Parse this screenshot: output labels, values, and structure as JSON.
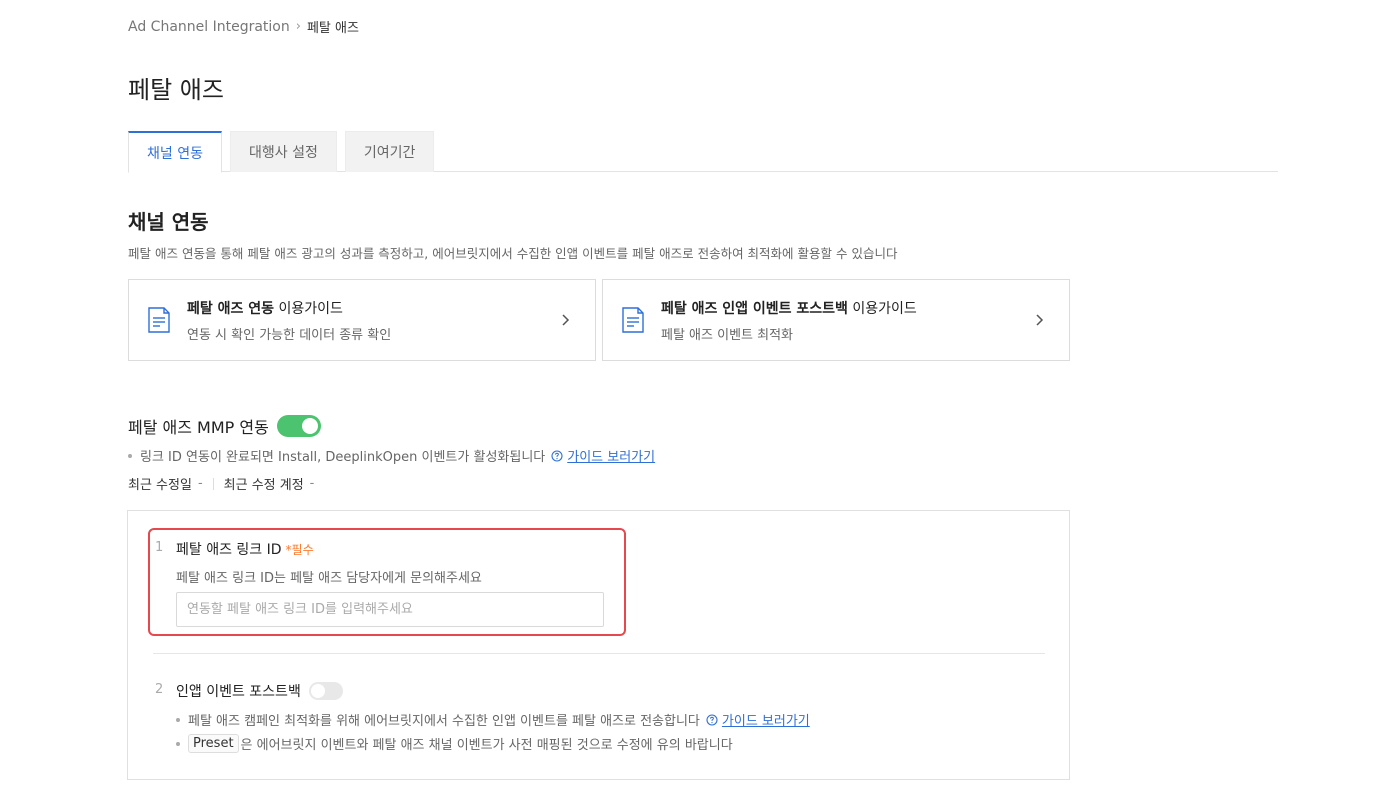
{
  "breadcrumb": {
    "parent": "Ad Channel Integration",
    "separator": "›",
    "current": "페탈 애즈"
  },
  "page_title": "페탈 애즈",
  "tabs": [
    {
      "label": "채널 연동",
      "active": true
    },
    {
      "label": "대행사 설정",
      "active": false
    },
    {
      "label": "기여기간",
      "active": false
    }
  ],
  "section": {
    "title": "채널 연동",
    "description": "페탈 애즈 연동을 통해 페탈 애즈 광고의 성과를 측정하고, 에어브릿지에서 수집한 인앱 이벤트를 페탈 애즈로 전송하여 최적화에 활용할 수 있습니다"
  },
  "guide_cards": [
    {
      "title_bold": "페탈 애즈 연동",
      "title_rest": " 이용가이드",
      "subtitle": "연동 시 확인 가능한 데이터 종류 확인",
      "icon": "document-icon"
    },
    {
      "title_bold": "페탈 애즈 인앱 이벤트 포스트백",
      "title_rest": " 이용가이드",
      "subtitle": "페탈 애즈 이벤트 최적화",
      "icon": "document-icon"
    }
  ],
  "mmp": {
    "title": "페탈 애즈 MMP 연동",
    "toggle_on": true,
    "note": "링크 ID 연동이 완료되면 Install, DeeplinkOpen 이벤트가 활성화됩니다",
    "guide_link": "가이드 보러가기",
    "last_modified_label": "최근 수정일",
    "last_modified_value": "-",
    "last_editor_label": "최근 수정 계정",
    "last_editor_value": "-"
  },
  "step1": {
    "number": "1",
    "title": "페탈 애즈 링크 ID",
    "required": "*필수",
    "description": "페탈 애즈 링크 ID는 페탈 애즈 담당자에게 문의해주세요",
    "input_value": "",
    "input_placeholder": "연동할 페탈 애즈 링크 ID를 입력해주세요"
  },
  "step2": {
    "number": "2",
    "title": "인앱 이벤트 포스트백",
    "toggle_on": false,
    "note1": "페탈 애즈 캠페인 최적화를 위해 에어브릿지에서 수집한 인앱 이벤트를 페탈 애즈로 전송합니다",
    "guide_link": "가이드 보러가기",
    "preset_tag": "Preset",
    "note2": "은 에어브릿지 이벤트와 페탈 애즈 채널 이벤트가 사전 매핑된 것으로 수정에 유의 바랍니다"
  },
  "colors": {
    "accent": "#2f6fd8",
    "toggle_on": "#4cc36f",
    "required": "#ff7a2e",
    "highlight": "#e5484d"
  }
}
